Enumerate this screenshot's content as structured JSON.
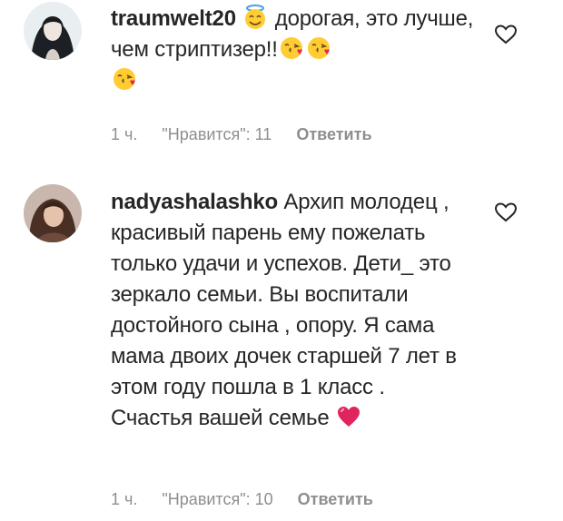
{
  "comments": [
    {
      "username": "traumwelt20",
      "text_parts": [
        "дорогая, это лучше, чем стриптизер!!"
      ],
      "emojis": [
        "smiling-halo-emoji",
        "kissing-face-emoji",
        "kissing-face-emoji",
        "kissing-face-emoji"
      ],
      "time": "1 ч.",
      "likes": "\"Нравится\": 11",
      "reply": "Ответить"
    },
    {
      "username": "nadyashalashko",
      "text": "Архип молодец , красивый парень ему пожелать только удачи и успехов. Дети_ это зеркало семьи. Вы воспитали достойного сына , опору. Я сама мама двоих дочек старшей 7 лет в этом году пошла в 1 класс . Счастья вашей семье",
      "emojis": [
        "red-heart-emoji"
      ],
      "time": "1 ч.",
      "likes": "\"Нравится\": 10",
      "reply": "Ответить"
    }
  ],
  "colors": {
    "text": "#262626",
    "meta": "#8e8e8e",
    "emoji_yellow": "#ffcc33",
    "heart_red": "#e0245e"
  }
}
